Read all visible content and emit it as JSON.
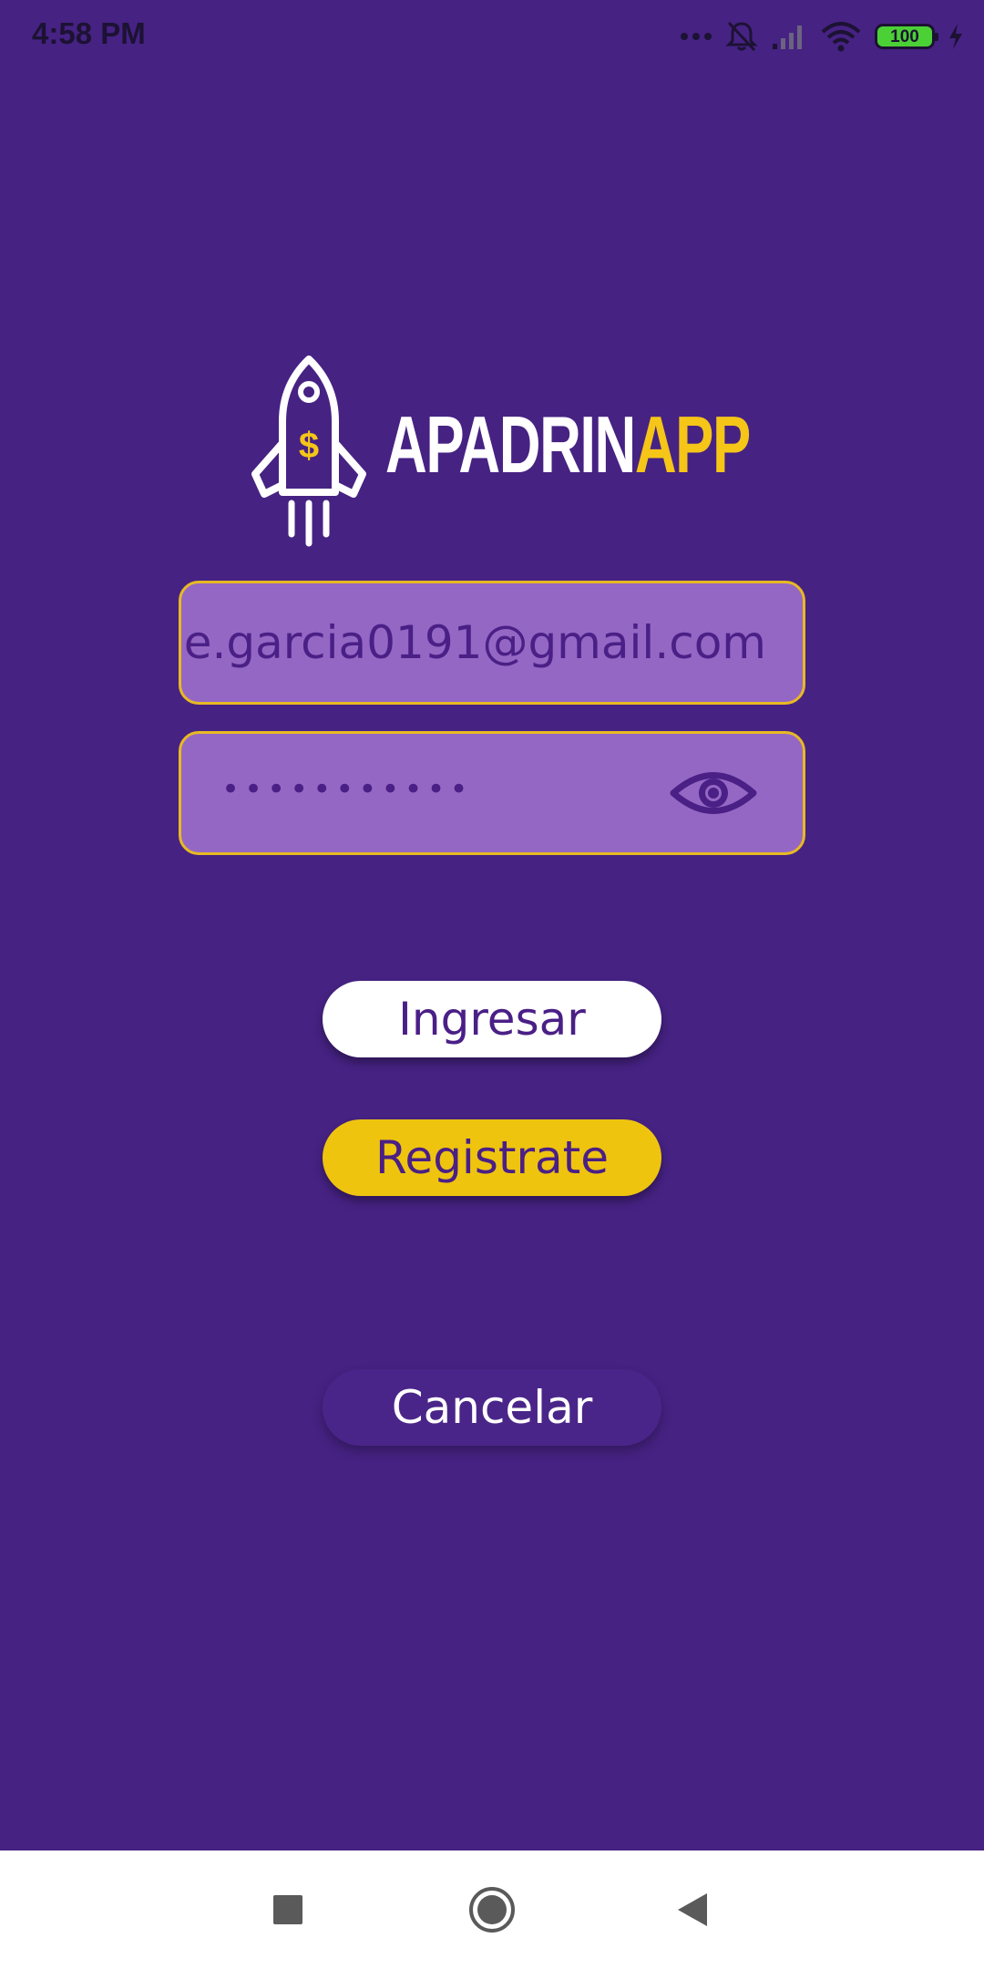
{
  "status_bar": {
    "time": "4:58 PM",
    "battery_level": "100",
    "icons": [
      "more-dots-icon",
      "notifications-off-icon",
      "signal-icon",
      "wifi-icon",
      "battery-icon",
      "charging-icon"
    ]
  },
  "logo": {
    "text_part1": "APADRIN",
    "text_part2": "APP",
    "icon": "rocket-dollar-icon",
    "colors": {
      "white": "#ffffff",
      "yellow": "#f5c518"
    }
  },
  "login_form": {
    "email_value": "e.garcia0191@gmail.com",
    "password_masked": "•••••••••••",
    "password_toggle_icon": "eye-icon"
  },
  "buttons": {
    "login_label": "Ingresar",
    "register_label": "Registrate",
    "cancel_label": "Cancelar"
  },
  "nav_bar": {
    "recents_icon": "square-recents-icon",
    "home_icon": "circle-home-icon",
    "back_icon": "triangle-back-icon"
  },
  "colors": {
    "background": "#462283",
    "field_fill": "#9467c4",
    "field_border": "#e8b923",
    "accent_yellow": "#eec40f",
    "text_purple": "#4a1f86"
  }
}
